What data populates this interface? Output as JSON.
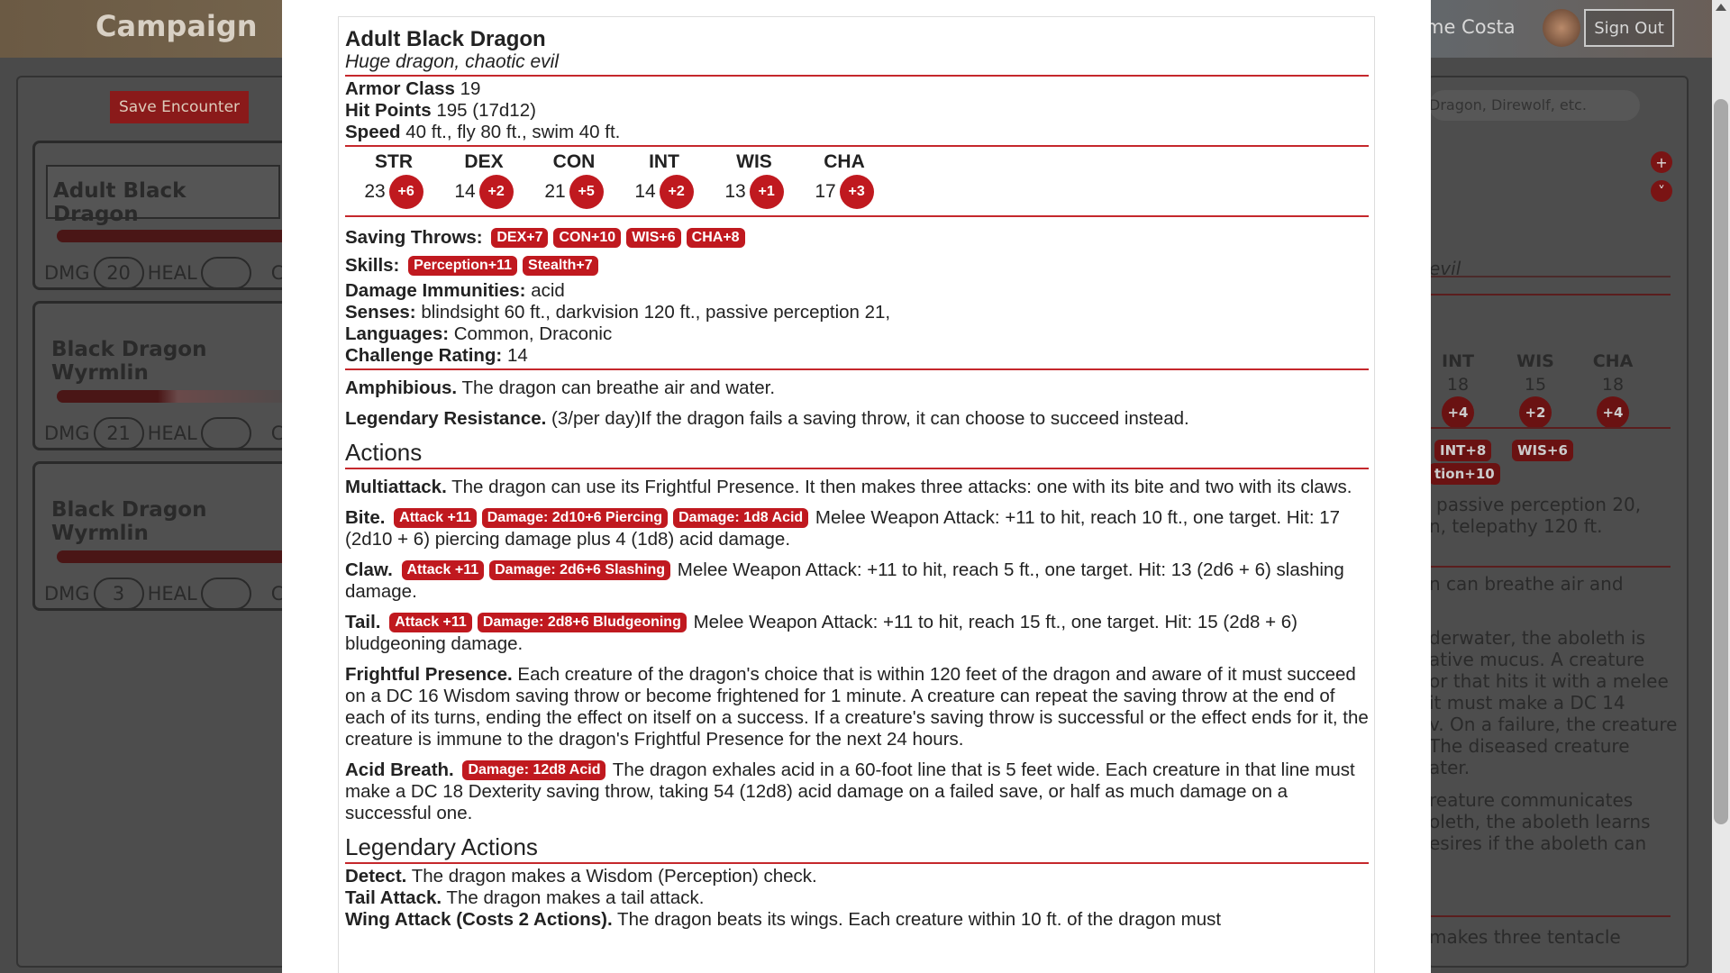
{
  "bg": {
    "brand": "Campaign",
    "user_name": "me Costa",
    "sign_out": "Sign Out",
    "save_encounter": "Save Encounter",
    "encounter_cards": [
      {
        "name": "Adult Black Dragon",
        "dmg_label": "DMG",
        "dmg": "20",
        "heal_label": "HEAL",
        "heal": "",
        "cond": "CO"
      },
      {
        "name": "Black Dragon Wyrmlin",
        "dmg_label": "DMG",
        "dmg": "21",
        "heal_label": "HEAL",
        "heal": "",
        "cond": "CO"
      },
      {
        "name": "Black Dragon Wyrmlin",
        "dmg_label": "DMG",
        "dmg": "3",
        "heal_label": "HEAL",
        "heal": "",
        "cond": "CO"
      }
    ],
    "search_placeholder": "Dragon, Direwolf, etc.",
    "add_icon": "+",
    "collapse_icon": "˅",
    "right_alignment": "evil",
    "right_abilities": [
      {
        "name": "INT",
        "score": "18",
        "mod": "+4"
      },
      {
        "name": "WIS",
        "score": "15",
        "mod": "+2"
      },
      {
        "name": "CHA",
        "score": "18",
        "mod": "+4"
      }
    ],
    "right_saves": [
      "INT+8",
      "WIS+6"
    ],
    "right_skill": "tion+10",
    "right_senses": [
      "passive perception 20,",
      "n, telepathy 120 ft."
    ],
    "right_trait": [
      "n can breathe air and"
    ],
    "right_mucus": [
      "derwater, the aboleth is",
      "ative mucus. A creature",
      "or that hits it with a melee",
      "it must make a DC 14",
      "v. On a failure, the creature",
      "The diseased creature",
      "ater."
    ],
    "right_probe": [
      "reature communicates",
      "oleth, the aboleth learns",
      "esires if the aboleth can"
    ],
    "right_multi": "makes three tentacle"
  },
  "monster": {
    "name": "Adult Black Dragon",
    "subtitle": "Huge dragon, chaotic evil",
    "ac_label": "Armor Class",
    "ac": "19",
    "hp_label": "Hit Points",
    "hp": "195 (17d12)",
    "speed_label": "Speed",
    "speed": "40 ft., fly 80 ft., swim 40 ft.",
    "abilities": [
      {
        "name": "STR",
        "score": "23",
        "mod": "+6"
      },
      {
        "name": "DEX",
        "score": "14",
        "mod": "+2"
      },
      {
        "name": "CON",
        "score": "21",
        "mod": "+5"
      },
      {
        "name": "INT",
        "score": "14",
        "mod": "+2"
      },
      {
        "name": "WIS",
        "score": "13",
        "mod": "+1"
      },
      {
        "name": "CHA",
        "score": "17",
        "mod": "+3"
      }
    ],
    "saves_label": "Saving Throws:",
    "saves": [
      "DEX+7",
      "CON+10",
      "WIS+6",
      "CHA+8"
    ],
    "skills_label": "Skills:",
    "skills": [
      "Perception+11",
      "Stealth+7"
    ],
    "immunities_label": "Damage Immunities:",
    "immunities": "acid",
    "senses_label": "Senses:",
    "senses": "blindsight 60 ft., darkvision 120 ft., passive perception 21,",
    "languages_label": "Languages:",
    "languages": "Common, Draconic",
    "cr_label": "Challenge Rating:",
    "cr": "14",
    "traits": [
      {
        "name": "Amphibious.",
        "text": "The dragon can breathe air and water."
      },
      {
        "name": "Legendary Resistance.",
        "text": "(3/per day)If the dragon fails a saving throw, it can choose to succeed instead."
      }
    ],
    "actions_header": "Actions",
    "multiattack": {
      "name": "Multiattack.",
      "text": "The dragon can use its Frightful Presence. It then makes three attacks: one with its bite and two with its claws."
    },
    "attacks": [
      {
        "name": "Bite.",
        "badges": [
          "Attack +11",
          "Damage: 2d10+6 Piercing",
          "Damage: 1d8 Acid"
        ],
        "text": "Melee Weapon Attack: +11 to hit, reach 10 ft., one target. Hit: 17 (2d10 + 6) piercing damage plus 4 (1d8) acid damage."
      },
      {
        "name": "Claw.",
        "badges": [
          "Attack +11",
          "Damage: 2d6+6 Slashing"
        ],
        "text": "Melee Weapon Attack: +11 to hit, reach 5 ft., one target. Hit: 13 (2d6 + 6) slashing damage."
      },
      {
        "name": "Tail.",
        "badges": [
          "Attack +11",
          "Damage: 2d8+6 Bludgeoning"
        ],
        "text": "Melee Weapon Attack: +11 to hit, reach 15 ft., one target. Hit: 15 (2d8 + 6) bludgeoning damage."
      }
    ],
    "frightful": {
      "name": "Frightful Presence.",
      "text": "Each creature of the dragon's choice that is within 120 feet of the dragon and aware of it must succeed on a DC 16 Wisdom saving throw or become frightened for 1 minute. A creature can repeat the saving throw at the end of each of its turns, ending the effect on itself on a success. If a creature's saving throw is successful or the effect ends for it, the creature is immune to the dragon's Frightful Presence for the next 24 hours."
    },
    "acid_breath": {
      "name": "Acid Breath.",
      "badge": "Damage: 12d8 Acid",
      "text": "The dragon exhales acid in a 60-foot line that is 5 feet wide. Each creature in that line must make a DC 18 Dexterity saving throw, taking 54 (12d8) acid damage on a failed save, or half as much damage on a successful one."
    },
    "legendary_header": "Legendary Actions",
    "legendary": [
      {
        "name": "Detect.",
        "text": "The dragon makes a Wisdom (Perception) check."
      },
      {
        "name": "Tail Attack.",
        "text": "The dragon makes a tail attack."
      },
      {
        "name": "Wing Attack (Costs 2 Actions).",
        "text": "The dragon beats its wings. Each creature within 10 ft. of the dragon must"
      }
    ]
  },
  "colors": {
    "accent": "#c0191f",
    "rule": "#c5282c"
  }
}
